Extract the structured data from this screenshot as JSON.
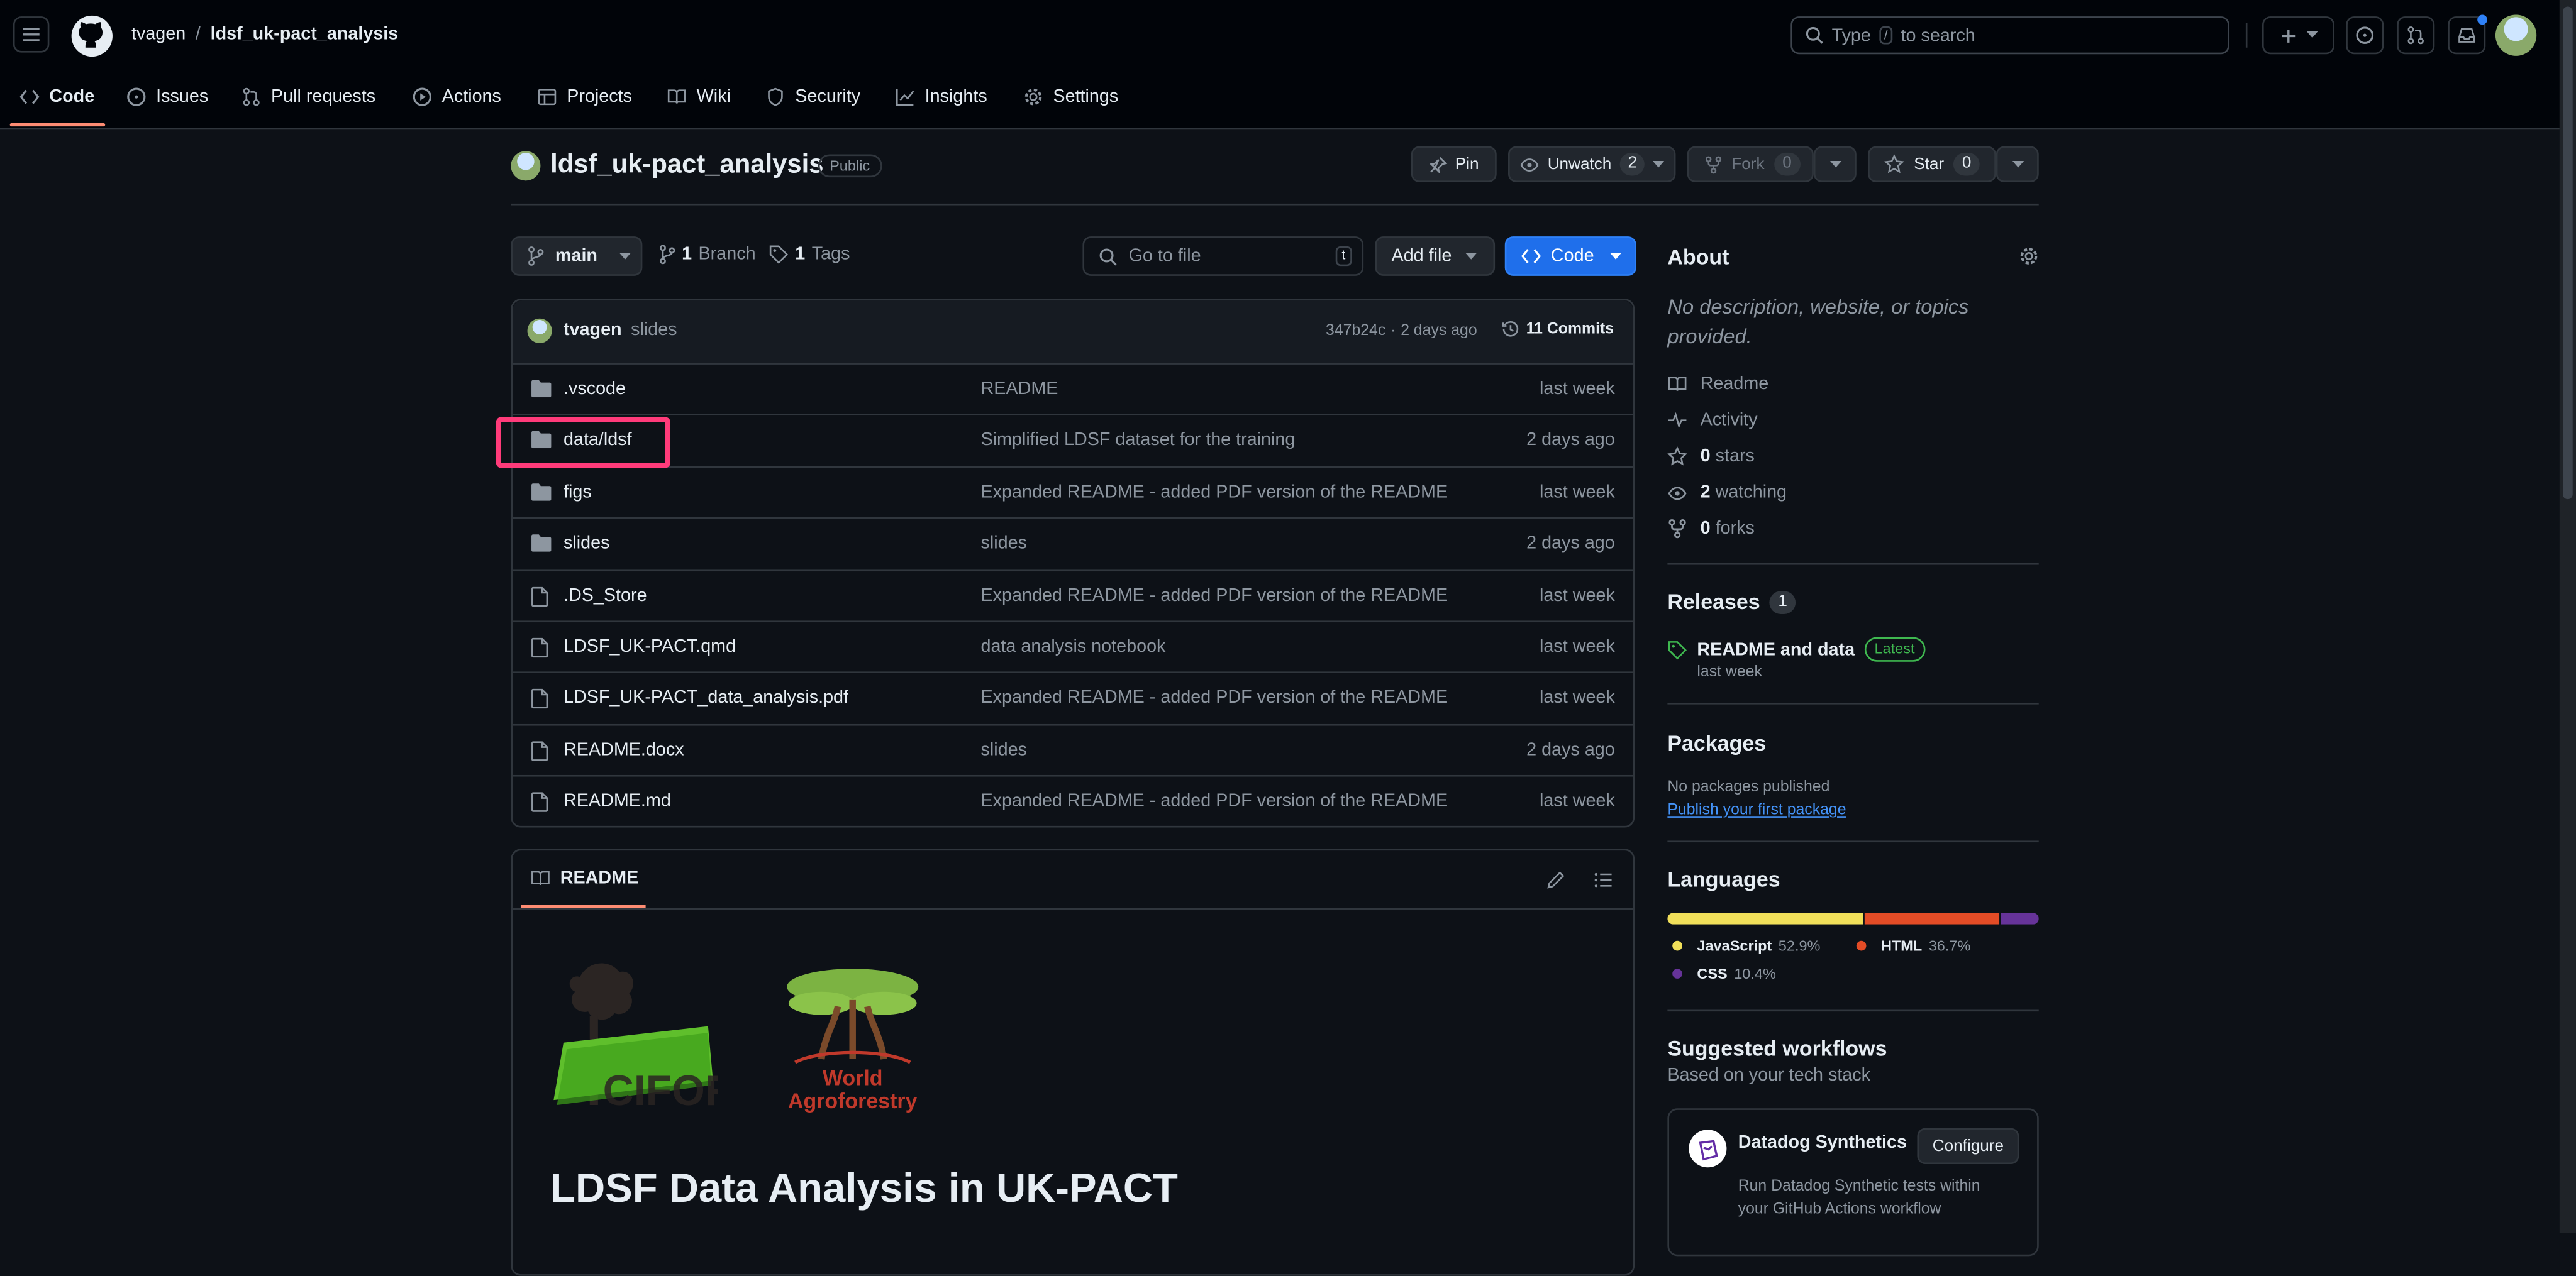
{
  "header": {
    "owner": "tvagen",
    "separator": "/",
    "repo": "ldsf_uk-pact_analysis",
    "search_prefix": "Type",
    "search_key": "/",
    "search_suffix": "to search"
  },
  "tabs": [
    {
      "label": "Code",
      "icon": "code-icon"
    },
    {
      "label": "Issues",
      "icon": "issue-icon"
    },
    {
      "label": "Pull requests",
      "icon": "pull-request-icon"
    },
    {
      "label": "Actions",
      "icon": "play-icon"
    },
    {
      "label": "Projects",
      "icon": "table-icon"
    },
    {
      "label": "Wiki",
      "icon": "book-icon"
    },
    {
      "label": "Security",
      "icon": "shield-icon"
    },
    {
      "label": "Insights",
      "icon": "graph-icon"
    },
    {
      "label": "Settings",
      "icon": "gear-icon"
    }
  ],
  "repo_header": {
    "name": "ldsf_uk-pact_analysis",
    "visibility": "Public",
    "pin": "Pin",
    "unwatch": "Unwatch",
    "watch_count": "2",
    "fork": "Fork",
    "fork_count": "0",
    "star": "Star",
    "star_count": "0"
  },
  "toolbar": {
    "branch": "main",
    "branches_count": "1",
    "branches_label": "Branch",
    "tags_count": "1",
    "tags_label": "Tags",
    "go_to_file": "Go to file",
    "go_to_file_key": "t",
    "add_file": "Add file",
    "code": "Code"
  },
  "commit": {
    "author": "tvagen",
    "message": "slides",
    "hash": "347b24c",
    "dot": "·",
    "age": "2 days ago",
    "count": "11 Commits"
  },
  "files": [
    {
      "type": "folder",
      "name": ".vscode",
      "message": "README",
      "date": "last week"
    },
    {
      "type": "folder",
      "name": "data/ldsf",
      "message": "Simplified LDSF dataset for the training",
      "date": "2 days ago"
    },
    {
      "type": "folder",
      "name": "figs",
      "message": "Expanded README - added PDF version of the README",
      "date": "last week"
    },
    {
      "type": "folder",
      "name": "slides",
      "message": "slides",
      "date": "2 days ago"
    },
    {
      "type": "file",
      "name": ".DS_Store",
      "message": "Expanded README - added PDF version of the README",
      "date": "last week"
    },
    {
      "type": "file",
      "name": "LDSF_UK-PACT.qmd",
      "message": "data analysis notebook",
      "date": "last week"
    },
    {
      "type": "file",
      "name": "LDSF_UK-PACT_data_analysis.pdf",
      "message": "Expanded README - added PDF version of the README",
      "date": "last week"
    },
    {
      "type": "file",
      "name": "README.docx",
      "message": "slides",
      "date": "2 days ago"
    },
    {
      "type": "file",
      "name": "README.md",
      "message": "Expanded README - added PDF version of the README",
      "date": "last week"
    }
  ],
  "readme": {
    "tab": "README",
    "logo1_text": "CIFOR",
    "logo2_line1": "World",
    "logo2_line2": "Agroforestry",
    "heading": "LDSF Data Analysis in UK-PACT"
  },
  "about": {
    "title": "About",
    "description": "No description, website, or topics provided.",
    "readme": "Readme",
    "activity": "Activity",
    "stars_count": "0",
    "stars_label": "stars",
    "watching_count": "2",
    "watching_label": "watching",
    "forks_count": "0",
    "forks_label": "forks"
  },
  "releases": {
    "title": "Releases",
    "count": "1",
    "name": "README and data",
    "badge": "Latest",
    "date": "last week"
  },
  "packages": {
    "title": "Packages",
    "empty": "No packages published",
    "link": "Publish your first package"
  },
  "languages": {
    "title": "Languages",
    "items": [
      {
        "name": "JavaScript",
        "percent": "52.9%",
        "value": 52.9,
        "color": "#f1e05a"
      },
      {
        "name": "HTML",
        "percent": "36.7%",
        "value": 36.7,
        "color": "#e34c26"
      },
      {
        "name": "CSS",
        "percent": "10.4%",
        "value": 10.4,
        "color": "#663399"
      }
    ]
  },
  "workflows": {
    "title": "Suggested workflows",
    "subtitle": "Based on your tech stack",
    "item_name": "Datadog Synthetics",
    "configure": "Configure",
    "desc_line1": "Run Datadog Synthetic tests within",
    "desc_line2": "your GitHub Actions workflow"
  },
  "colors": {
    "accent": "#2f81f7",
    "highlight": "#ff3b7a",
    "tab_underline": "#fd8c73"
  }
}
